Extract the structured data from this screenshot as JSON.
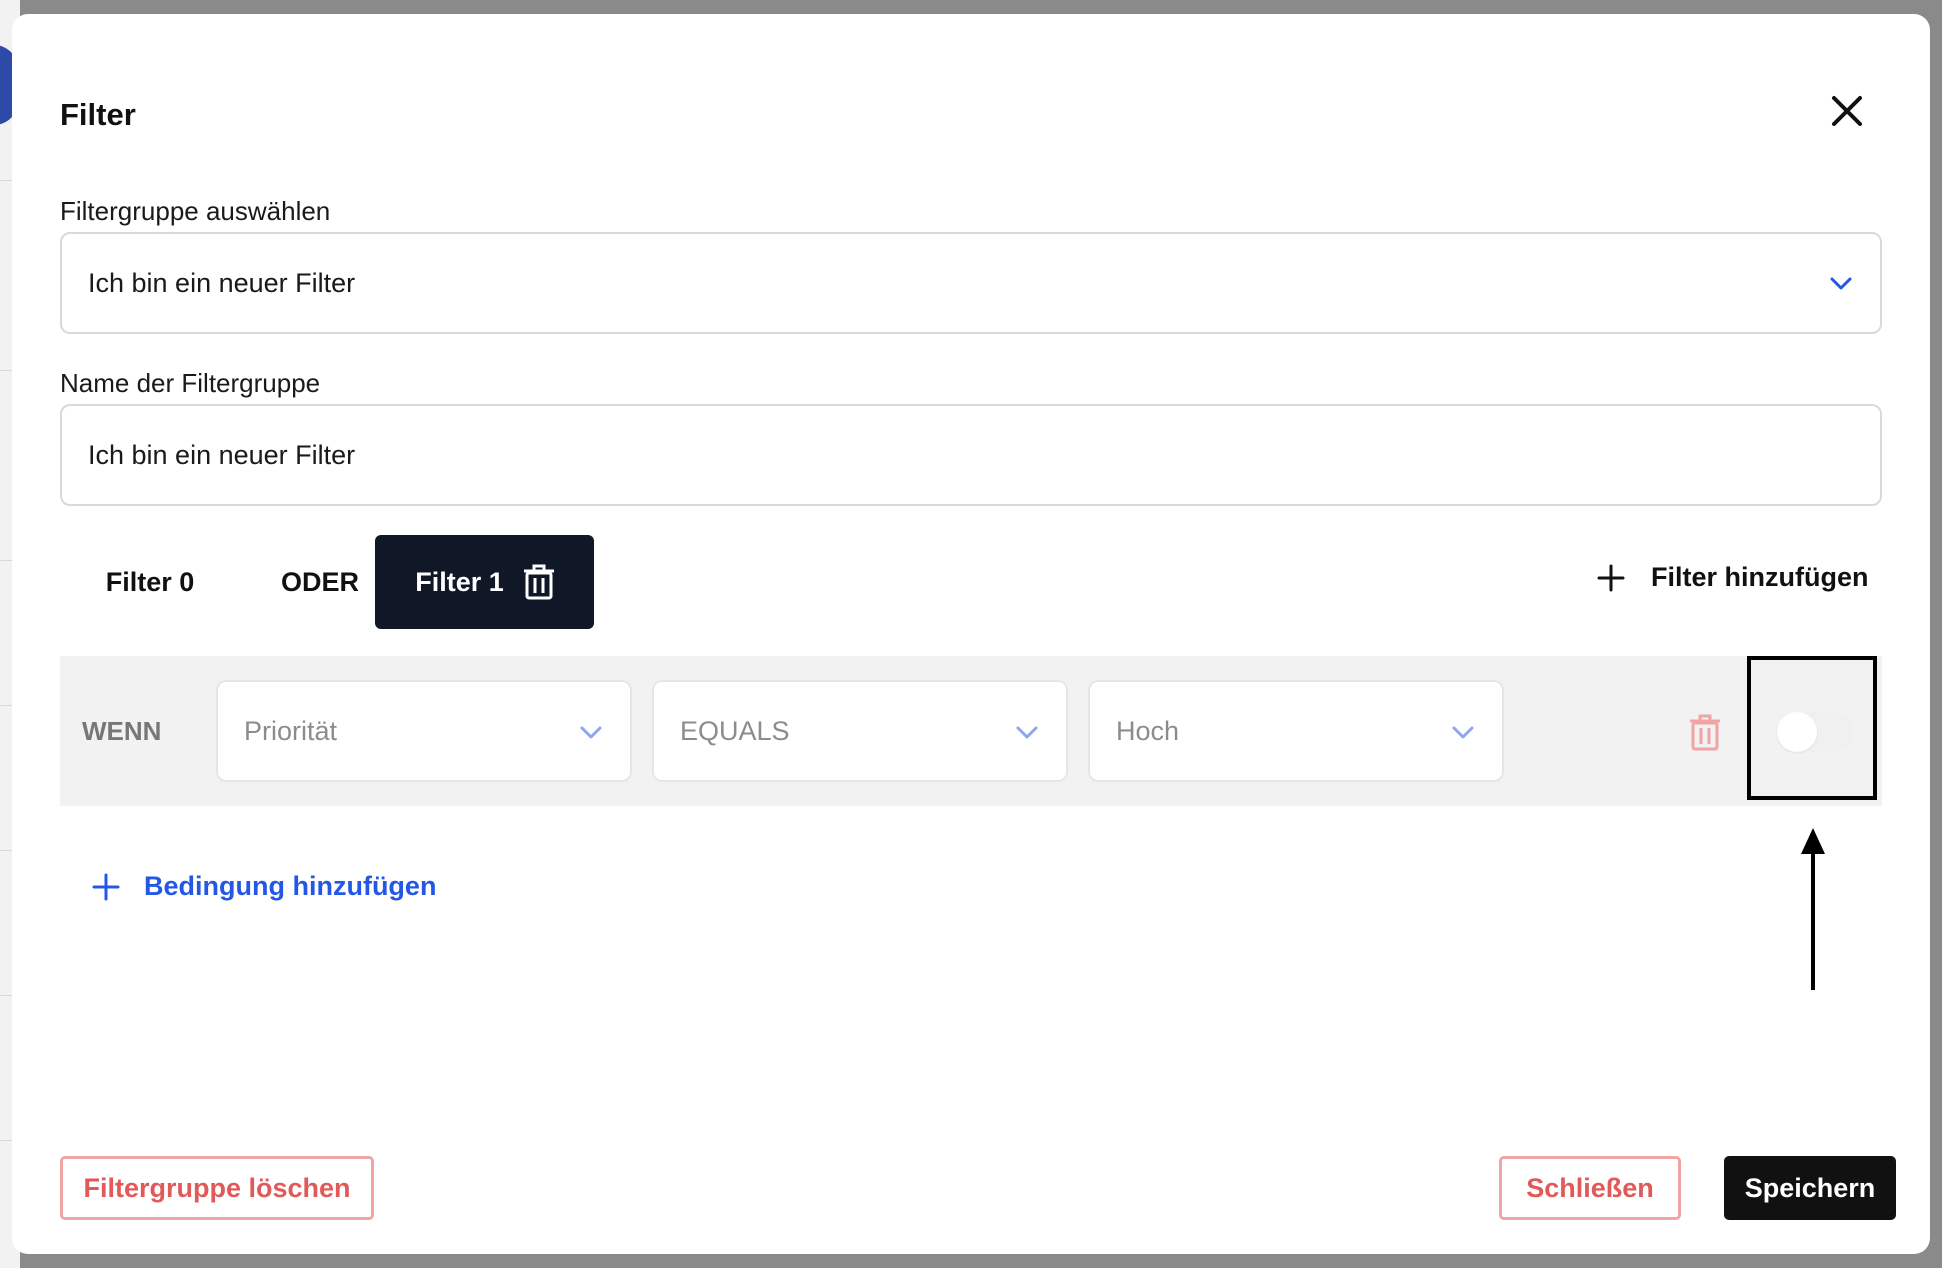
{
  "modal": {
    "title": "Filter",
    "close_icon": "close-icon"
  },
  "filter_group": {
    "select_label": "Filtergruppe auswählen",
    "select_value": "Ich bin ein neuer Filter",
    "name_label": "Name der Filtergruppe",
    "name_value": "Ich bin ein neuer Filter"
  },
  "tabs": [
    {
      "label": "Filter 0",
      "active": false
    },
    {
      "label": "ODER",
      "active": false
    },
    {
      "label": "Filter 1",
      "active": true
    }
  ],
  "add_filter_label": "Filter hinzufügen",
  "condition": {
    "prefix": "WENN",
    "field": "Priorität",
    "operator": "EQUALS",
    "value": "Hoch",
    "toggle_on": false
  },
  "add_condition_label": "Bedingung hinzufügen",
  "footer": {
    "delete_group_label": "Filtergruppe löschen",
    "close_label": "Schließen",
    "save_label": "Speichern"
  },
  "colors": {
    "accent_blue": "#2457e6",
    "dark_tab": "#101828",
    "danger": "#e05a5a",
    "danger_border": "#f0a4a4",
    "row_bg": "#f2f2f2"
  }
}
